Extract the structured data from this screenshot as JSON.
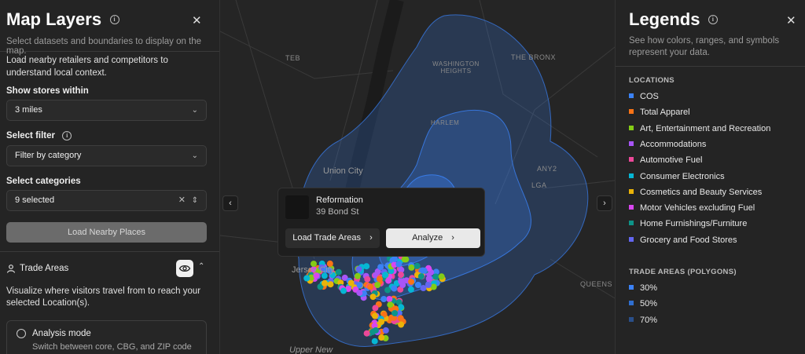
{
  "left_panel": {
    "title": "Map Layers",
    "subtitle": "Select datasets and boundaries to display on the map.",
    "description": "Load nearby retailers and competitors to understand local context.",
    "show_stores_label": "Show stores within",
    "show_stores_value": "3 miles",
    "select_filter_label": "Select filter",
    "select_filter_value": "Filter by category",
    "select_categories_label": "Select categories",
    "select_categories_value": "9 selected",
    "load_button": "Load Nearby Places",
    "trade_areas_label": "Trade Areas",
    "trade_areas_desc": "Visualize where visitors travel from to reach your selected Location(s).",
    "analysis_mode_title": "Analysis mode",
    "analysis_mode_sub": "Switch between core, CBG, and ZIP code"
  },
  "map": {
    "labels": {
      "teb": "TEB",
      "washington_heights": "WASHINGTON HEIGHTS",
      "the_bronx": "THE BRONX",
      "harlem": "HARLEM",
      "union_city": "Union City",
      "lga": "LGA",
      "any2": "ANY2",
      "queens": "QUEENS",
      "jersey_city": "Jersey City",
      "upper_new": "Upper New"
    },
    "popup": {
      "name": "Reformation",
      "address": "39 Bond St",
      "load_trade_areas": "Load Trade Areas",
      "analyze": "Analyze"
    }
  },
  "right_panel": {
    "title": "Legends",
    "subtitle": "See how colors, ranges, and symbols represent your data.",
    "locations_header": "LOCATIONS",
    "locations": [
      {
        "label": "COS",
        "color": "#3b82f6"
      },
      {
        "label": "Total Apparel",
        "color": "#f97316"
      },
      {
        "label": "Art, Entertainment and Recreation",
        "color": "#84cc16"
      },
      {
        "label": "Accommodations",
        "color": "#a855f7"
      },
      {
        "label": "Automotive Fuel",
        "color": "#ec4899"
      },
      {
        "label": "Consumer Electronics",
        "color": "#06b6d4"
      },
      {
        "label": "Cosmetics and Beauty Services",
        "color": "#eab308"
      },
      {
        "label": "Motor Vehicles excluding Fuel",
        "color": "#d946ef"
      },
      {
        "label": "Home Furnishings/Furniture",
        "color": "#0d9488"
      },
      {
        "label": "Grocery and Food Stores",
        "color": "#6366f1"
      }
    ],
    "trade_areas_header": "TRADE AREAS (POLYGONS)",
    "trade_areas": [
      {
        "label": "30%",
        "color": "#3b82f6"
      },
      {
        "label": "50%",
        "color": "#2f6fd0"
      },
      {
        "label": "70%",
        "color": "#2a4f8a"
      }
    ]
  }
}
